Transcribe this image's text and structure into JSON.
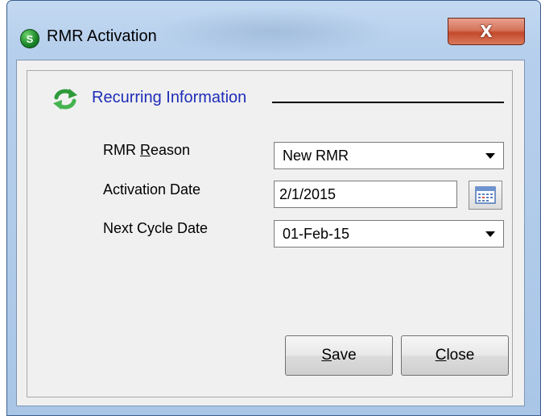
{
  "window": {
    "title": "RMR Activation",
    "icon_letter": "S",
    "close_glyph": "X"
  },
  "section": {
    "title": "Recurring Information",
    "icon": "refresh-icon"
  },
  "fields": {
    "reason": {
      "label_pre": "RMR ",
      "label_accel": "R",
      "label_post": "eason",
      "value": "New RMR"
    },
    "activation_date": {
      "label": "Activation Date",
      "value": "2/1/2015"
    },
    "next_cycle_date": {
      "label": "Next Cycle Date",
      "value": "01-Feb-15"
    }
  },
  "buttons": {
    "save_accel": "S",
    "save_rest": "ave",
    "close_accel": "C",
    "close_rest": "lose"
  },
  "colors": {
    "section_title": "#1f2db8",
    "close_button": "#c4492c",
    "app_icon": "#1f8a2c"
  }
}
